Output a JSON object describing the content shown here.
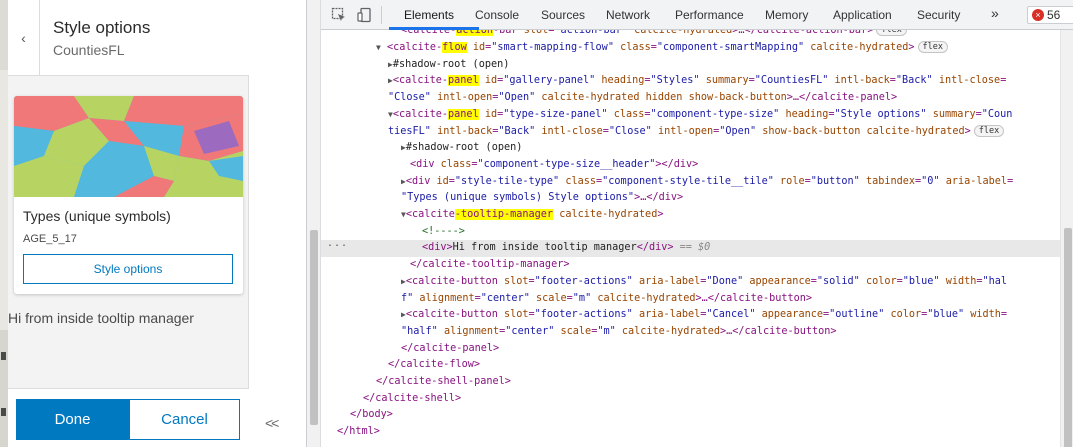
{
  "panel": {
    "title": "Style options",
    "summary": "CountiesFL",
    "back_icon": "chevron-left-icon",
    "card": {
      "title": "Types (unique symbols)",
      "field": "AGE_5_17",
      "button_label": "Style options"
    },
    "tooltip_text": "Hi from inside tooltip manager",
    "footer": {
      "done_label": "Done",
      "cancel_label": "Cancel"
    },
    "collapse_label": "<<",
    "colors": {
      "accent": "#0079c1",
      "map_red": "#f07878",
      "map_green": "#b7d463",
      "map_blue": "#52b8de",
      "map_purple": "#9c6bc0"
    }
  },
  "devtools": {
    "tabs": [
      "Elements",
      "Console",
      "Sources",
      "Network",
      "Performance",
      "Memory",
      "Application",
      "Security"
    ],
    "active_tab": "Elements",
    "more_label": "»",
    "error_count": "56",
    "selected_line_suffix": "== $0",
    "dots_label": "..."
  }
}
